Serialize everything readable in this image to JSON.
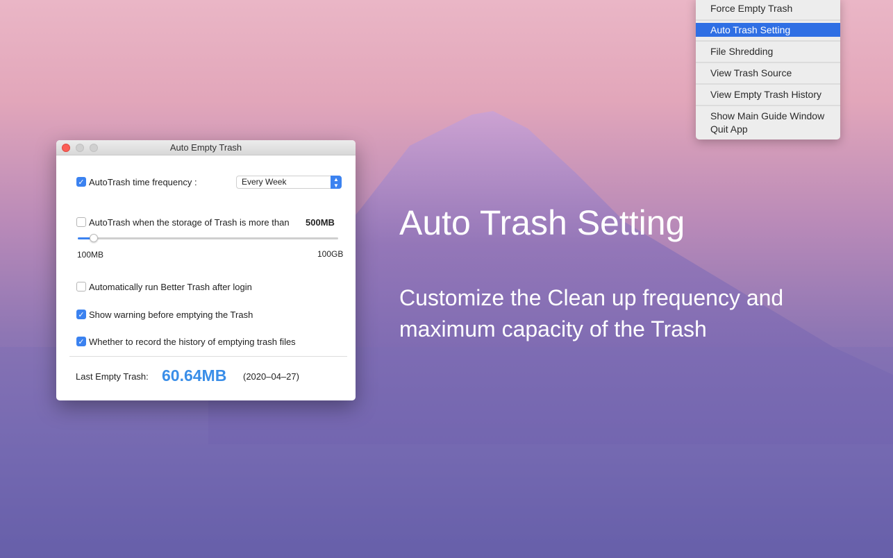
{
  "window": {
    "title": "Auto Empty Trash",
    "frequency": {
      "label": "AutoTrash time frequency :",
      "checked": true,
      "selected": "Every Week"
    },
    "storage": {
      "label": "AutoTrash when the storage of Trash is more than",
      "checked": false,
      "value": "500MB",
      "min_label": "100MB",
      "max_label": "100GB",
      "slider_fraction": 0.06
    },
    "options": [
      {
        "label": "Automatically run Better Trash after login",
        "checked": false
      },
      {
        "label": "Show warning before emptying the Trash",
        "checked": true
      },
      {
        "label": "Whether to record the history of emptying trash files",
        "checked": true
      }
    ],
    "last": {
      "label": "Last Empty Trash:",
      "size": "60.64MB",
      "date": "(2020–04–27)"
    }
  },
  "menu": {
    "items": [
      "Force Empty Trash",
      "Auto Trash Setting",
      "File Shredding",
      "View Trash Source",
      "View Empty Trash History",
      "Show Main Guide Window",
      "Quit App"
    ],
    "selected_index": 1
  },
  "hero": {
    "title": "Auto Trash Setting",
    "line1": "Customize the Clean up frequency and",
    "line2": "maximum capacity of the Trash"
  },
  "colors": {
    "accent": "#3b82f0",
    "menu_highlight": "#2f6fe4",
    "size_text": "#3a8ee8"
  }
}
